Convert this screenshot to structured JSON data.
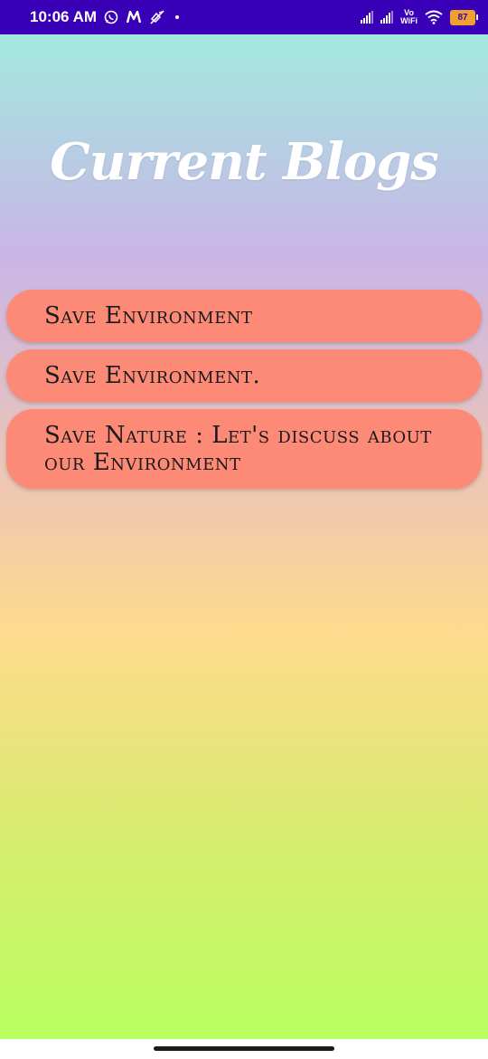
{
  "status_bar": {
    "time": "10:06 AM",
    "battery": "87",
    "vowifi_top": "Vo",
    "vowifi_bottom": "WiFi",
    "icons": [
      "whatsapp-icon",
      "m-icon",
      "mute-icon",
      "dot-icon",
      "signal-icon",
      "signal-icon",
      "vowifi-icon",
      "wifi-icon",
      "battery-icon"
    ]
  },
  "page": {
    "title": "Current Blogs"
  },
  "blogs": [
    {
      "title": "Save Environment"
    },
    {
      "title": "Save Environment."
    },
    {
      "title": "Save Nature : Let's discuss about our Environment"
    }
  ],
  "colors": {
    "status_bar": "#3a00b8",
    "card": "#fd8a77",
    "gradient_top": "#a3e9e0",
    "gradient_bottom": "#b9ff61"
  }
}
